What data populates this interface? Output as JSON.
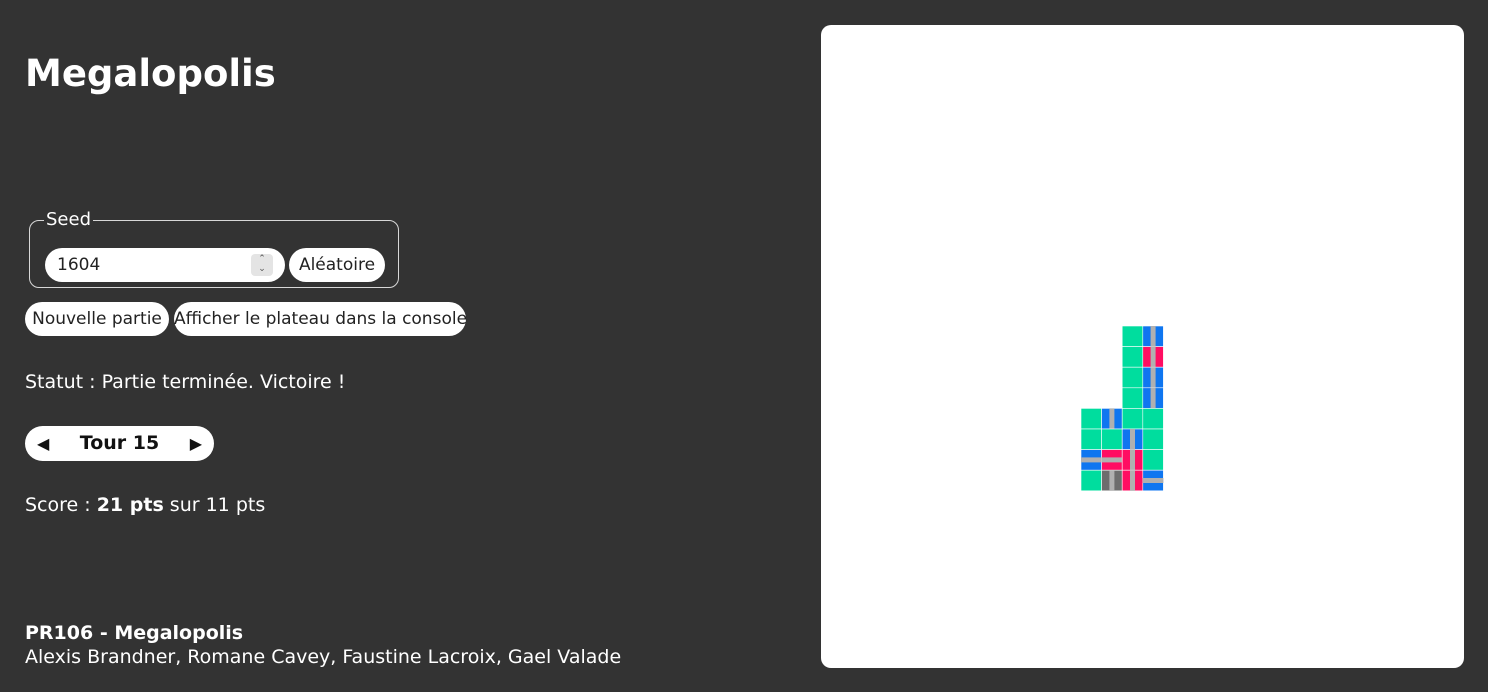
{
  "app": {
    "title": "Megalopolis"
  },
  "seed": {
    "legend": "Seed",
    "value": "1604",
    "random_label": "Aléatoire"
  },
  "actions": {
    "new_game_label": "Nouvelle partie",
    "console_label": "Afficher le plateau dans la console"
  },
  "status": {
    "text": "Statut : Partie terminée. Victoire !"
  },
  "turn": {
    "label": "Tour 15",
    "prev_symbol": "◀",
    "next_symbol": "▶"
  },
  "score": {
    "prefix": "Score : ",
    "value": "21 pts",
    "suffix": " sur 11 pts"
  },
  "footer": {
    "title": "PR106 - Megalopolis",
    "authors": "Alexis Brandner, Romane Cavey, Faustine Lacroix, Gael Valade"
  },
  "board": {
    "colors": {
      "park": "#00dd9e",
      "office": "#0f76f0",
      "housing": "#ff0d62",
      "industry": "#6d6d6d",
      "road": "#b0b0b0"
    },
    "cells": [
      {
        "row": 0,
        "col": 2,
        "type": "park"
      },
      {
        "row": 0,
        "col": 3,
        "type": "office",
        "road": "v"
      },
      {
        "row": 1,
        "col": 2,
        "type": "park"
      },
      {
        "row": 1,
        "col": 3,
        "type": "housing",
        "road": "v"
      },
      {
        "row": 2,
        "col": 2,
        "type": "park"
      },
      {
        "row": 2,
        "col": 3,
        "type": "office",
        "road": "v"
      },
      {
        "row": 3,
        "col": 2,
        "type": "park"
      },
      {
        "row": 3,
        "col": 3,
        "type": "office",
        "road": "v"
      },
      {
        "row": 4,
        "col": 0,
        "type": "park"
      },
      {
        "row": 4,
        "col": 1,
        "type": "office",
        "road": "v"
      },
      {
        "row": 4,
        "col": 2,
        "type": "park"
      },
      {
        "row": 4,
        "col": 3,
        "type": "park"
      },
      {
        "row": 5,
        "col": 0,
        "type": "park"
      },
      {
        "row": 5,
        "col": 1,
        "type": "park"
      },
      {
        "row": 5,
        "col": 2,
        "type": "office",
        "road": "v"
      },
      {
        "row": 5,
        "col": 3,
        "type": "park"
      },
      {
        "row": 6,
        "col": 0,
        "type": "office",
        "road": "h"
      },
      {
        "row": 6,
        "col": 1,
        "type": "housing",
        "road": "h"
      },
      {
        "row": 6,
        "col": 2,
        "type": "housing",
        "road": "v"
      },
      {
        "row": 6,
        "col": 3,
        "type": "park"
      },
      {
        "row": 7,
        "col": 0,
        "type": "park"
      },
      {
        "row": 7,
        "col": 1,
        "type": "industry",
        "road": "v"
      },
      {
        "row": 7,
        "col": 2,
        "type": "housing",
        "road": "v"
      },
      {
        "row": 7,
        "col": 3,
        "type": "office",
        "road": "h"
      }
    ]
  }
}
